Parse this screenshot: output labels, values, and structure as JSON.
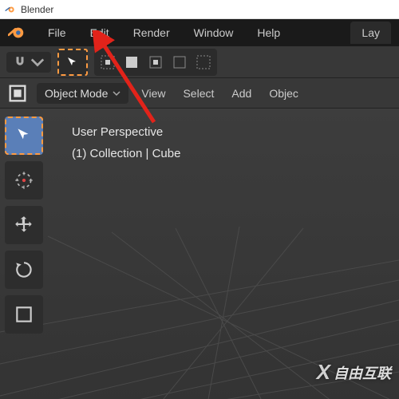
{
  "titlebar": {
    "title": "Blender"
  },
  "menubar": {
    "items": [
      "File",
      "Edit",
      "Render",
      "Window",
      "Help"
    ],
    "tab_right": "Lay"
  },
  "toolbar2": {
    "mode_label": "Object Mode",
    "items": [
      "View",
      "Select",
      "Add",
      "Objec"
    ]
  },
  "viewport": {
    "line1": "User Perspective",
    "line2": "(1) Collection | Cube"
  },
  "watermark": {
    "text": "自由互联"
  }
}
